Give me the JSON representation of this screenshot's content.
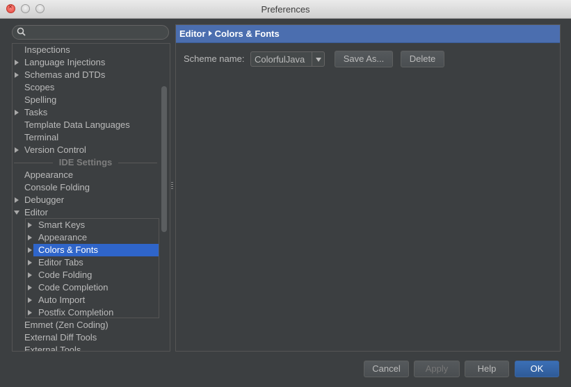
{
  "window": {
    "title": "Preferences"
  },
  "search": {
    "placeholder": ""
  },
  "tree": {
    "items": [
      {
        "label": "Inspections"
      },
      {
        "label": "Language Injections"
      },
      {
        "label": "Schemas and DTDs"
      },
      {
        "label": "Scopes"
      },
      {
        "label": "Spelling"
      },
      {
        "label": "Tasks"
      },
      {
        "label": "Template Data Languages"
      },
      {
        "label": "Terminal"
      },
      {
        "label": "Version Control"
      }
    ],
    "section_label": "IDE Settings",
    "ide_items": [
      {
        "label": "Appearance"
      },
      {
        "label": "Console Folding"
      },
      {
        "label": "Debugger"
      },
      {
        "label": "Editor"
      }
    ],
    "editor_children": [
      {
        "label": "Smart Keys"
      },
      {
        "label": "Appearance"
      },
      {
        "label": "Colors & Fonts"
      },
      {
        "label": "Editor Tabs"
      },
      {
        "label": "Code Folding"
      },
      {
        "label": "Code Completion"
      },
      {
        "label": "Auto Import"
      },
      {
        "label": "Postfix Completion"
      }
    ],
    "after_items": [
      {
        "label": "Emmet (Zen Coding)"
      },
      {
        "label": "External Diff Tools"
      },
      {
        "label": "External Tools"
      }
    ],
    "selected": "Colors & Fonts"
  },
  "breadcrumb": {
    "parent": "Editor",
    "current": "Colors & Fonts"
  },
  "scheme": {
    "label": "Scheme name:",
    "value": "ColorfulJava"
  },
  "buttons": {
    "save_as": "Save As...",
    "delete": "Delete",
    "cancel": "Cancel",
    "apply": "Apply",
    "help": "Help",
    "ok": "OK"
  },
  "colors": {
    "accent": "#2f65ca",
    "breadcrumb_bg": "#4b6eaf",
    "background": "#3c3f41"
  }
}
